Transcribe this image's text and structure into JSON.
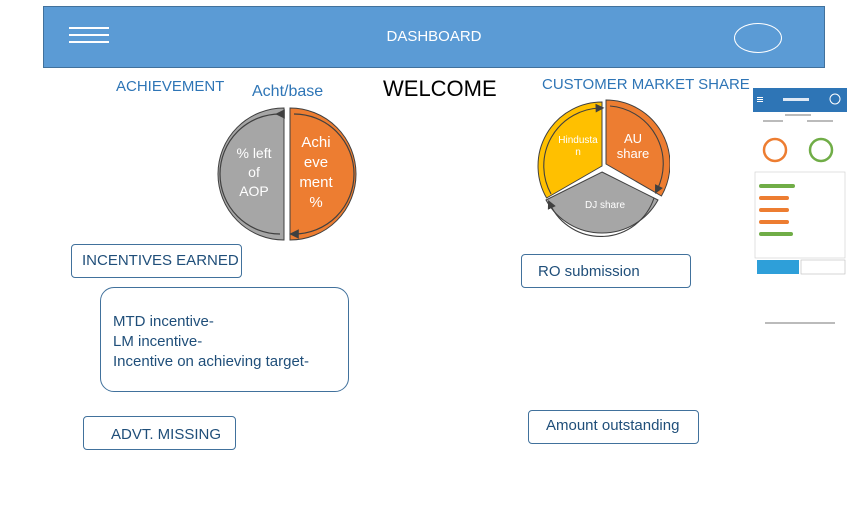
{
  "header": {
    "title": "DASHBOARD",
    "menu_icon": "hamburger-icon",
    "profile_icon": "profile-oval-icon",
    "color": "#5b9bd5"
  },
  "welcome": "WELCOME",
  "achievement": {
    "title": "ACHIEVEMENT",
    "subtitle": "Acht/base",
    "left_segment": [
      "% left",
      "of",
      "AOP"
    ],
    "right_segment": [
      "Achi",
      "eve",
      "ment",
      "%"
    ],
    "colors": {
      "left": "#a6a6a6",
      "right": "#ed7d31"
    }
  },
  "market_share": {
    "title": "CUSTOMER MARKET SHARE",
    "segments": [
      {
        "lines": [
          "Hindusta",
          "n"
        ],
        "color": "#ffc000"
      },
      {
        "lines": [
          "AU",
          "share"
        ],
        "color": "#ed7d31"
      },
      {
        "lines": [
          "DJ share"
        ],
        "color": "#a6a6a6"
      }
    ]
  },
  "incentives": {
    "label": "INCENTIVES EARNED",
    "lines": [
      "MTD incentive-",
      "LM incentive-",
      "Incentive on achieving target-"
    ]
  },
  "advt_missing": "ADVT. MISSING",
  "ro_submission": "RO submission",
  "amount_outstanding": "Amount outstanding"
}
